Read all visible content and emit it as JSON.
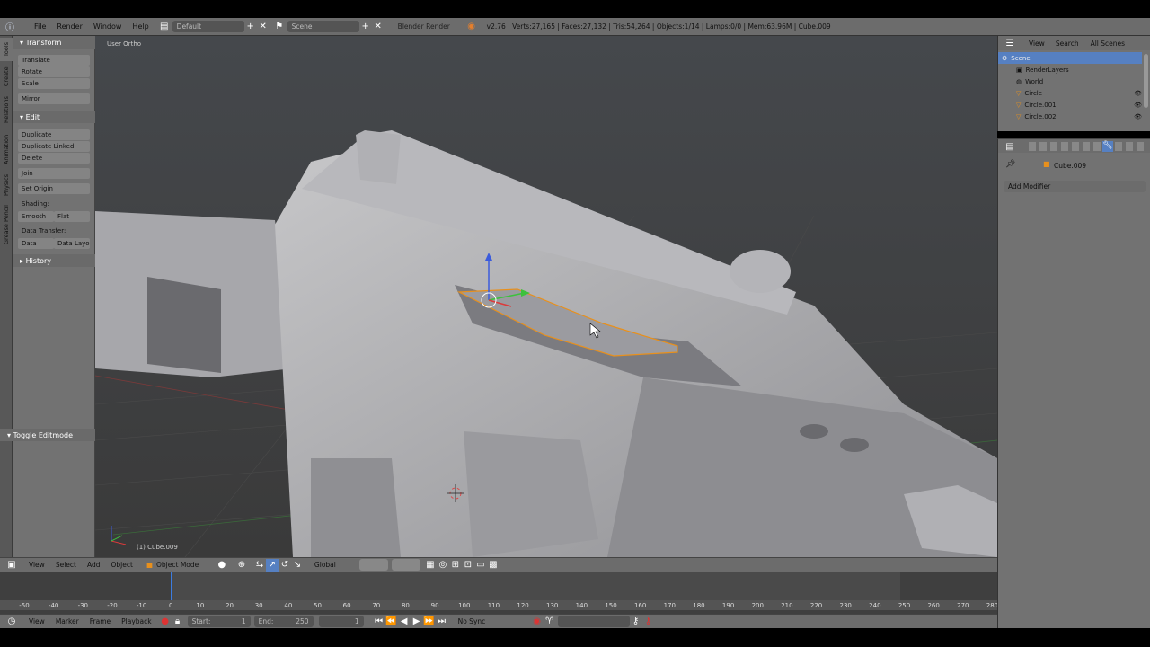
{
  "topbar": {
    "menus": [
      "File",
      "Render",
      "Window",
      "Help"
    ],
    "layout": "Default",
    "scene": "Scene",
    "engine": "Blender Render",
    "stats": "v2.76 | Verts:27,165 | Faces:27,132 | Tris:54,264 | Objects:1/14 | Lamps:0/0 | Mem:63.96M | Cube.009"
  },
  "tabs": [
    "Tools",
    "Create",
    "Relations",
    "Animation",
    "Physics",
    "Grease Pencil"
  ],
  "toolshelf": {
    "transform": {
      "title": "Transform",
      "items": [
        "Translate",
        "Rotate",
        "Scale",
        "Mirror"
      ]
    },
    "edit": {
      "title": "Edit",
      "items": [
        "Duplicate",
        "Duplicate Linked",
        "Delete",
        "Join",
        "Set Origin"
      ],
      "shading_label": "Shading:",
      "smooth": "Smooth",
      "flat": "Flat",
      "data_transfer_label": "Data Transfer:",
      "data": "Data",
      "data_layo": "Data Layo"
    },
    "history": "History",
    "operator": "Toggle Editmode"
  },
  "viewport": {
    "view_label": "User Ortho",
    "object_label": "(1) Cube.009"
  },
  "vpheader": {
    "menus": [
      "View",
      "Select",
      "Add",
      "Object"
    ],
    "mode": "Object Mode",
    "orientation": "Global"
  },
  "timeline": {
    "ticks": [
      "-50",
      "-40",
      "-30",
      "-20",
      "-10",
      "0",
      "10",
      "20",
      "30",
      "40",
      "50",
      "60",
      "70",
      "80",
      "90",
      "100",
      "110",
      "120",
      "130",
      "140",
      "150",
      "160",
      "170",
      "180",
      "190",
      "200",
      "210",
      "220",
      "230",
      "240",
      "250",
      "260",
      "270",
      "280"
    ],
    "menus": [
      "View",
      "Marker",
      "Frame",
      "Playback"
    ],
    "start_label": "Start:",
    "start": "1",
    "end_label": "End:",
    "end": "250",
    "current": "1",
    "sync": "No Sync"
  },
  "outliner": {
    "menus": [
      "View",
      "Search"
    ],
    "filter": "All Scenes",
    "rows": [
      "Scene",
      "RenderLayers",
      "World",
      "Circle",
      "Circle.001",
      "Circle.002"
    ]
  },
  "properties": {
    "object": "Cube.009",
    "add_modifier": "Add Modifier"
  },
  "colors": {
    "selection": "#e8901c",
    "header": "#6c6c6c",
    "panel": "#727272",
    "viewport_bg": "#3d3d3d"
  }
}
